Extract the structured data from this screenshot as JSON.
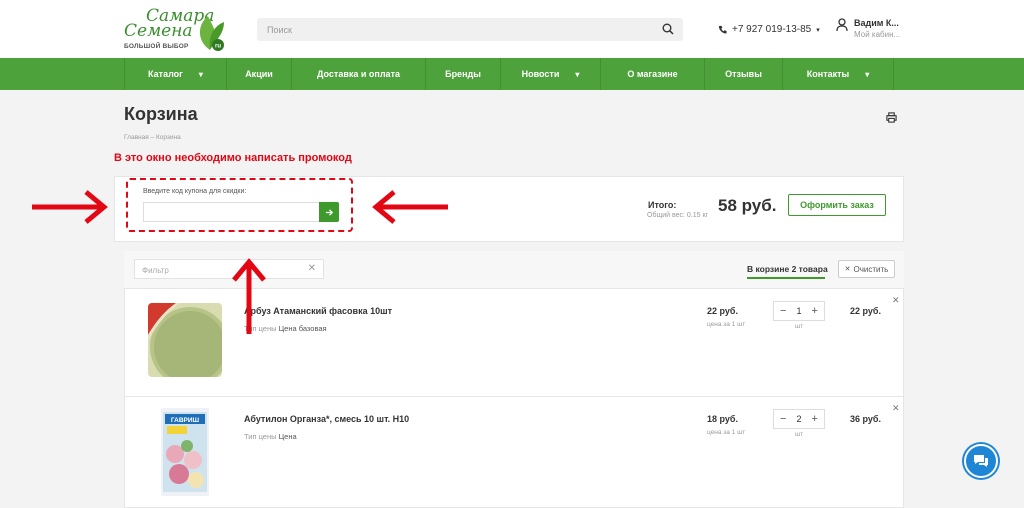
{
  "header": {
    "logo_line1": "Самара",
    "logo_line2": "Семена",
    "logo_line3": "БОЛЬШОЙ ВЫБОР",
    "logo_badge": "ru",
    "search_placeholder": "Поиск",
    "phone": "+7 927 019-13-85",
    "user_name": "Вадим К...",
    "user_sub": "Мой кабин..."
  },
  "nav": {
    "items": [
      {
        "label": "Каталог",
        "has_dropdown": true
      },
      {
        "label": "Акции",
        "has_dropdown": false
      },
      {
        "label": "Доставка и оплата",
        "has_dropdown": false
      },
      {
        "label": "Бренды",
        "has_dropdown": false
      },
      {
        "label": "Новости",
        "has_dropdown": true
      },
      {
        "label": "О магазине",
        "has_dropdown": false
      },
      {
        "label": "Отзывы",
        "has_dropdown": false
      },
      {
        "label": "Контакты",
        "has_dropdown": true
      }
    ]
  },
  "page": {
    "title": "Корзина",
    "breadcrumb": "Главная – Корзина",
    "annotation": "В это окно необходимо написать промокод"
  },
  "coupon": {
    "label": "Введите код купона для скидки:",
    "value": ""
  },
  "total": {
    "label": "Итого:",
    "weight": "Общий вес: 0.15 кг",
    "sum": "58 руб.",
    "order_button": "Оформить заказ"
  },
  "cart_toolbar": {
    "filter_placeholder": "Фильтр",
    "count_label": "В корзине 2 товара",
    "clear_label": "Очистить"
  },
  "items": [
    {
      "name": "Арбуз Атаманский фасовка 10шт",
      "price_type_label": "Тип цены",
      "price_type": "Цена базовая",
      "price": "22 руб.",
      "unit_label": "цена за 1 шт",
      "qty": "1",
      "qty_unit": "шт",
      "sum": "22 руб."
    },
    {
      "name": "Абутилон Органза*, смесь 10 шт. Н10",
      "price_type_label": "Тип цены",
      "price_type": "Цена",
      "price": "18 руб.",
      "unit_label": "цена за 1 шт",
      "qty": "2",
      "qty_unit": "шт",
      "sum": "36 руб.",
      "package_brand": "ГАВРИШ"
    }
  ],
  "colors": {
    "nav_green": "#4ea23b",
    "accent_green": "#3f9a2e",
    "annotation_red": "#e30613",
    "chat_blue": "#1f86d6"
  }
}
